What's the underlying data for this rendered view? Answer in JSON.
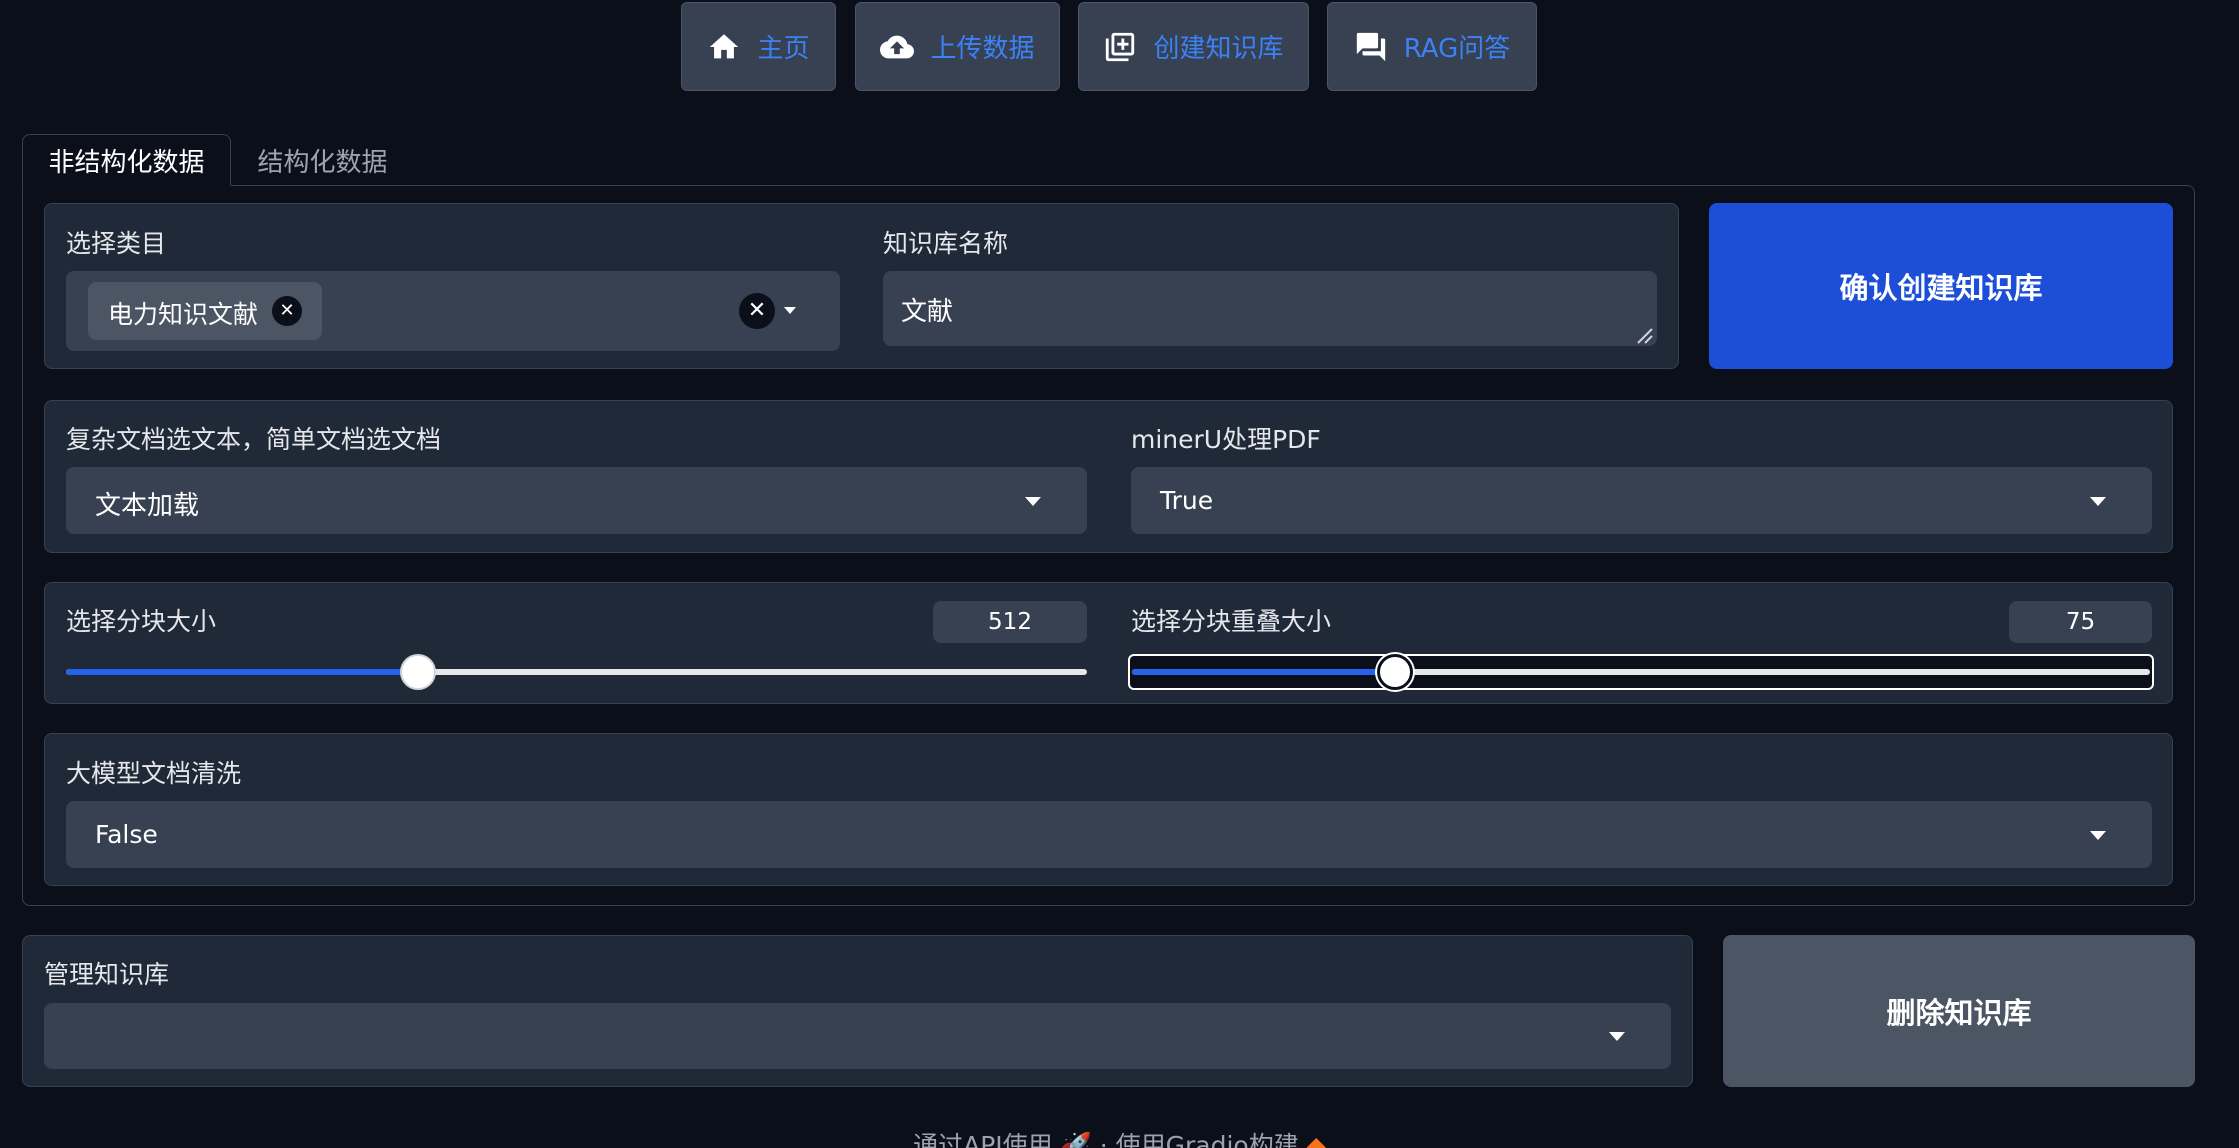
{
  "nav": {
    "home_label": "主页",
    "upload_label": "上传数据",
    "create_kb_label": "创建知识库",
    "rag_label": "RAG问答"
  },
  "tabs": [
    {
      "label": "非结构化数据",
      "active": true
    },
    {
      "label": "结构化数据",
      "active": false
    }
  ],
  "category": {
    "label": "选择类目",
    "selected_chip": "电力知识文献"
  },
  "kb_name": {
    "label": "知识库名称",
    "value": "文献"
  },
  "confirm_button": "确认创建知识库",
  "doc_mode": {
    "label": "复杂文档选文本，简单文档选文档",
    "value": "文本加载"
  },
  "mineru": {
    "label": "minerU处理PDF",
    "value": "True"
  },
  "chunk_size": {
    "label": "选择分块大小",
    "value": "512",
    "fraction": 0.345
  },
  "chunk_overlap": {
    "label": "选择分块重叠大小",
    "value": "75",
    "fraction": 0.258
  },
  "llm_clean": {
    "label": "大模型文档清洗",
    "value": "False"
  },
  "manage": {
    "label": "管理知识库",
    "value": ""
  },
  "delete_button": "删除知识库",
  "footer": {
    "api_text": "通过API使用",
    "separator": "·",
    "built_text": "使用Gradio构建"
  },
  "colors": {
    "background": "#0b0f19",
    "card": "#1f2937",
    "field": "#374151",
    "accent": "#1d4ed8",
    "nav_text": "#3b82f6"
  }
}
